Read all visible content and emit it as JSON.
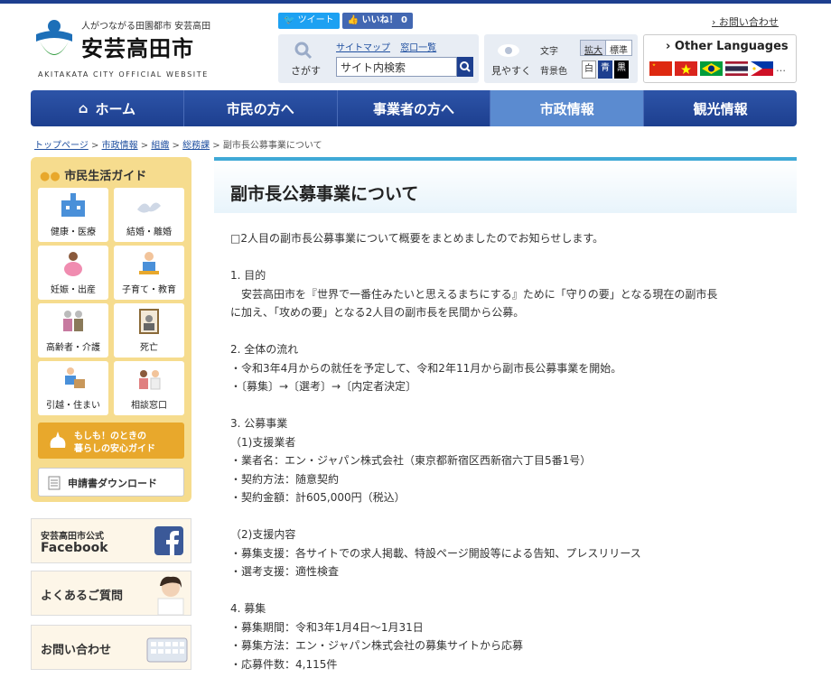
{
  "header": {
    "tagline": "人がつながる田園都市 安芸高田",
    "city_name": "安芸高田市",
    "city_en": "AKITAKATA CITY OFFICIAL WEBSITE",
    "tweet_label": "ツイート",
    "like_label": "いいね！ 0",
    "contact_link": "お問い合わせ"
  },
  "search": {
    "label": "さがす",
    "sitemap": "サイトマップ",
    "counter": "窓口一覧",
    "placeholder": "サイト内検索"
  },
  "view": {
    "label": "見やすく",
    "text_label": "文字",
    "bg_label": "背景色",
    "size_large": "拡大",
    "size_normal": "標準",
    "color_white": "白",
    "color_blue": "青",
    "color_black": "黒"
  },
  "languages": {
    "title": "Other Languages",
    "more": "…"
  },
  "nav": {
    "items": [
      "ホーム",
      "市民の方へ",
      "事業者の方へ",
      "市政情報",
      "観光情報"
    ],
    "active": "市政情報"
  },
  "breadcrumb": {
    "items": [
      "トップページ",
      "市政情報",
      "組織",
      "総務課"
    ],
    "current": "副市長公募事業について",
    "separator": ">"
  },
  "sidebar": {
    "title": "市民生活ガイド",
    "items": [
      "健康・医療",
      "結婚・離婚",
      "妊娠・出産",
      "子育て・教育",
      "高齢者・介護",
      "死亡",
      "引越・住まい",
      "相談窓口"
    ],
    "emergency_line1": "もしも！のときの",
    "emergency_line2": "暮らしの安心ガイド",
    "download": "申請書ダウンロード"
  },
  "banners": {
    "facebook_line1": "安芸高田市公式",
    "facebook_line2": "Facebook",
    "faq": "よくあるご質問",
    "contact": "お問い合わせ"
  },
  "article": {
    "title": "副市長公募事業について",
    "lines": [
      "□2人目の副市長公募事業について概要をまとめましたのでお知らせします。",
      "",
      "1. 目的",
      "　安芸高田市を『世界で一番住みたいと思えるまちにする』ために「守りの要」となる現在の副市長",
      "に加え、「攻めの要」となる2人目の副市長を民間から公募。",
      "",
      "2. 全体の流れ",
      "・令和3年4月からの就任を予定して、令和2年11月から副市長公募事業を開始。",
      "・〔募集〕→〔選考〕→〔内定者決定〕",
      "",
      "3. 公募事業",
      "（1)支援業者",
      "・業者名：エン・ジャパン株式会社（東京都新宿区西新宿六丁目5番1号）",
      "・契約方法：随意契約",
      "・契約金額：計605,000円（税込）",
      "",
      "（2)支援内容",
      "・募集支援：各サイトでの求人掲載、特設ページ開設等による告知、プレスリリース",
      "・選考支援：適性検査",
      "",
      "4. 募集",
      "・募集期間：令和3年1月4日～1月31日",
      "・募集方法：エン・ジャパン株式会社の募集サイトから応募",
      "・応募件数：4,115件"
    ]
  }
}
